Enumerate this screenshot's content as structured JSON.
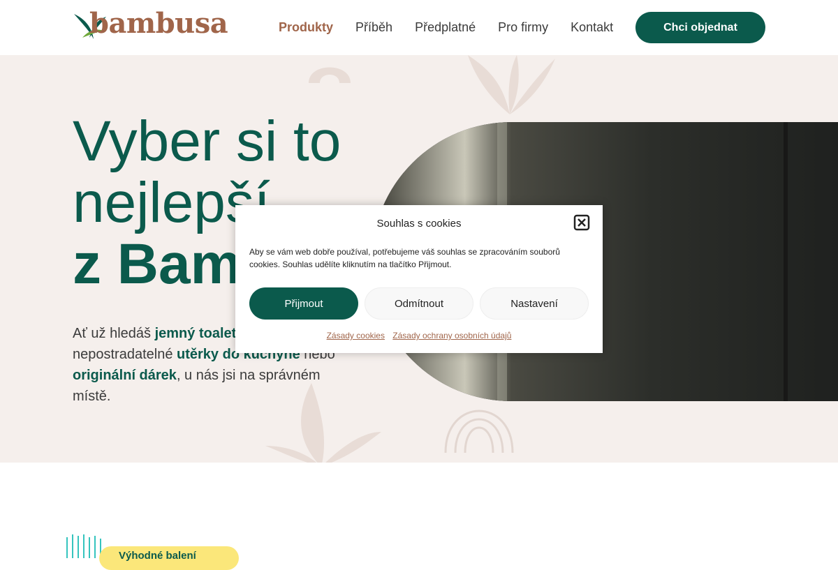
{
  "header": {
    "logo_text": "bambusa",
    "nav": [
      "Produkty",
      "Příběh",
      "Předplatné",
      "Pro firmy",
      "Kontakt"
    ],
    "cta": "Chci objednat"
  },
  "hero": {
    "title_line1": "Vyber si to",
    "title_line2": "nejlepší",
    "title_line3": "z Bambusy",
    "text_pre": "Ať už hledáš ",
    "text_b1": "jemný toaletní papír",
    "text_mid1": ", nepostradatelné ",
    "text_b2": "utěrky do kuchyně",
    "text_mid2": " nebo ",
    "text_b3": "originální dárek",
    "text_post": ", u nás jsi na správném místě."
  },
  "lower": {
    "badge": "Výhodné balení"
  },
  "cookie_modal": {
    "title": "Souhlas s cookies",
    "body": "Aby se vám web dobře používal, potřebujeme váš souhlas se zpracováním souborů cookies. Souhlas udělíte kliknutím na tlačítko Přijmout.",
    "accept": "Přijmout",
    "deny": "Odmítnout",
    "settings": "Nastavení",
    "link_cookies": "Zásady cookies",
    "link_privacy": "Zásady ochrany osobních údajů"
  },
  "colors": {
    "brand_green": "#0b5a4c",
    "brand_brown": "#a0654a",
    "hero_bg": "#f5efec",
    "badge_yellow": "#fbe77a"
  }
}
